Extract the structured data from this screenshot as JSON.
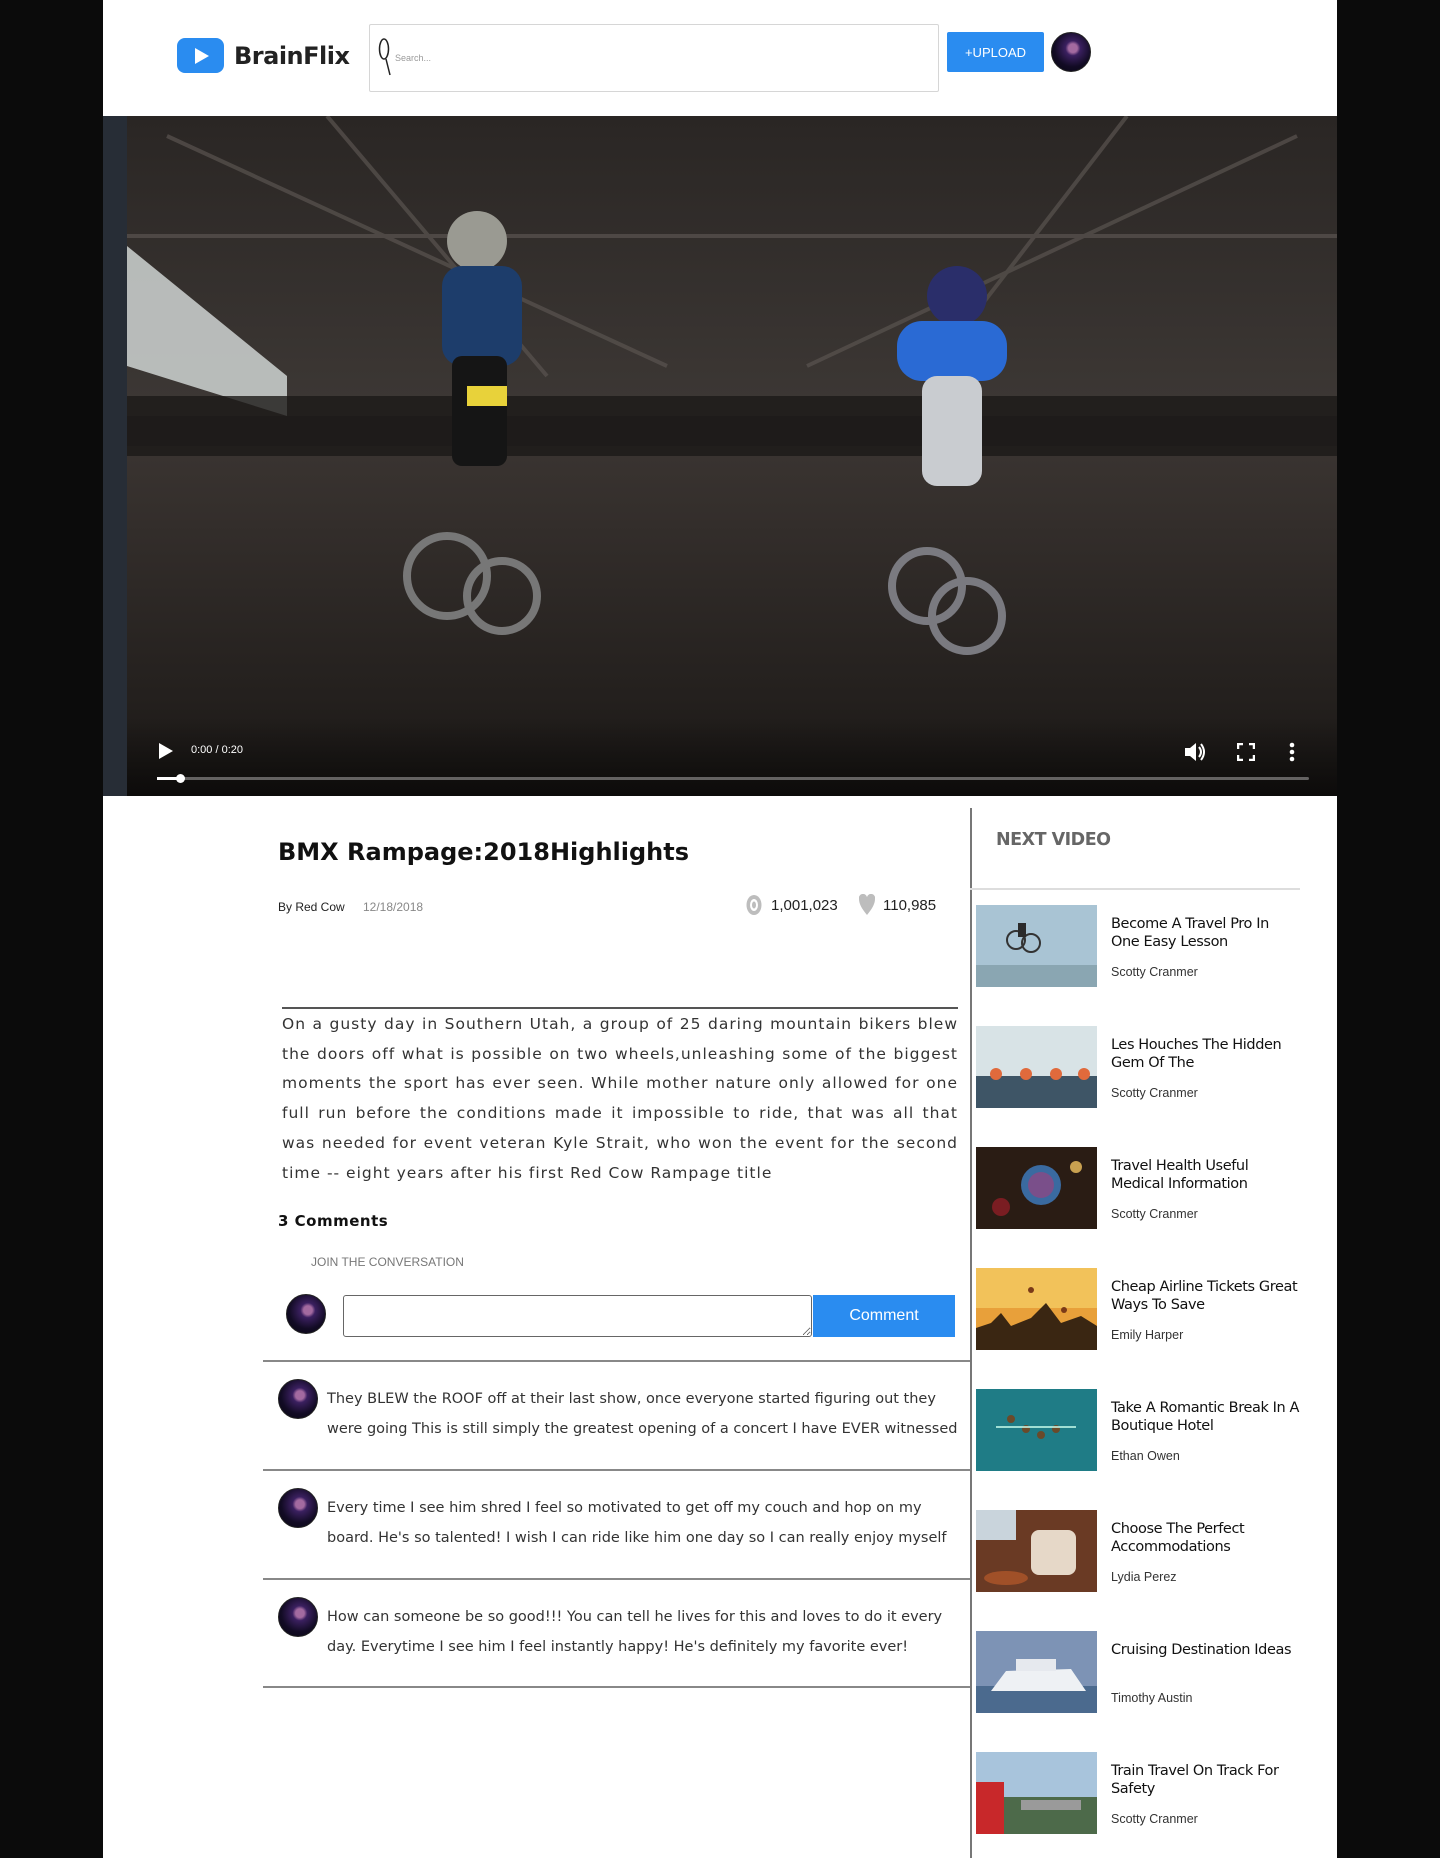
{
  "header": {
    "brand": "BrainFlix",
    "search_placeholder": "Search...",
    "upload_label": "+UPLOAD"
  },
  "player": {
    "time": "0:00 / 0:20",
    "progress": 0.02
  },
  "video": {
    "title": "BMX Rampage:2018Highlights",
    "author": "By Red Cow",
    "date": "12/18/2018",
    "views": "1,001,023",
    "likes": "110,985",
    "description": "On a gusty day in Southern Utah, a group of 25 daring mountain bikers blew the doors off what is possible on two wheels,unleashing some of the biggest moments the sport has ever seen. While mother nature only allowed for one full run before the conditions made it impossible to ride, that was all that was needed for event veteran Kyle Strait, who won the event for the second time -- eight years after his first Red Cow Rampage title"
  },
  "comments": {
    "count_label": "3 Comments",
    "join_label": "JOIN THE CONVERSATION",
    "button_label": "Comment",
    "items": [
      {
        "text": "They BLEW the ROOF off at their last show, once everyone started figuring out they were going This is still simply the greatest opening of a concert I have EVER witnessed"
      },
      {
        "text": "Every time I see him shred I feel so motivated to get off my couch and hop on my board. He's so talented! I wish I can ride like him one day so I can really enjoy myself"
      },
      {
        "text": "How can someone be so good!!! You can tell he lives for this and loves to do it every day. Everytime I see him I feel instantly happy! He's definitely my favorite ever!"
      }
    ]
  },
  "next_video": {
    "heading": "NEXT VIDEO",
    "items": [
      {
        "title": "Become A Travel Pro In One Easy Lesson",
        "author": "Scotty Cranmer"
      },
      {
        "title": "Les Houches The Hidden Gem Of The",
        "author": "Scotty Cranmer"
      },
      {
        "title": "Travel Health Useful Medical Information",
        "author": "Scotty Cranmer"
      },
      {
        "title": "Cheap Airline Tickets Great Ways To Save",
        "author": "Emily Harper"
      },
      {
        "title": "Take A Romantic Break In A Boutique Hotel",
        "author": "Ethan Owen"
      },
      {
        "title": "Choose The Perfect Accommodations",
        "author": "Lydia Perez"
      },
      {
        "title": "Cruising Destination Ideas",
        "author": "Timothy Austin"
      },
      {
        "title": "Train Travel On Track For Safety",
        "author": "Scotty Cranmer"
      }
    ]
  },
  "colors": {
    "accent": "#2a8cf0",
    "page_bg": "#0b0b0b"
  }
}
